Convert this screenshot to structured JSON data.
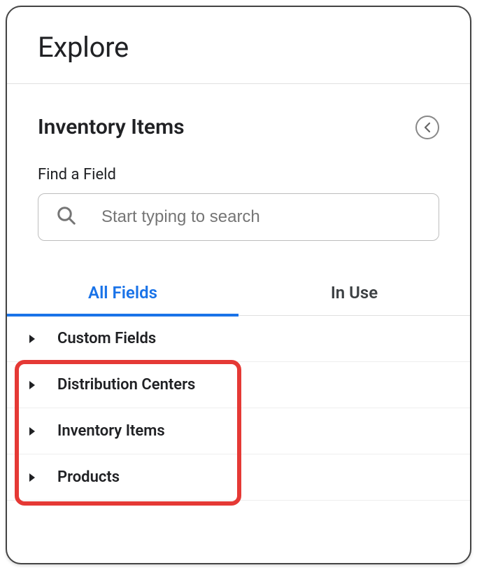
{
  "header": {
    "title": "Explore"
  },
  "panel": {
    "title": "Inventory Items",
    "find_label": "Find a Field",
    "search_placeholder": "Start typing to search"
  },
  "tabs": {
    "all": "All Fields",
    "in_use": "In Use"
  },
  "groups": [
    {
      "label": "Custom Fields"
    },
    {
      "label": "Distribution Centers"
    },
    {
      "label": "Inventory Items"
    },
    {
      "label": "Products"
    }
  ]
}
